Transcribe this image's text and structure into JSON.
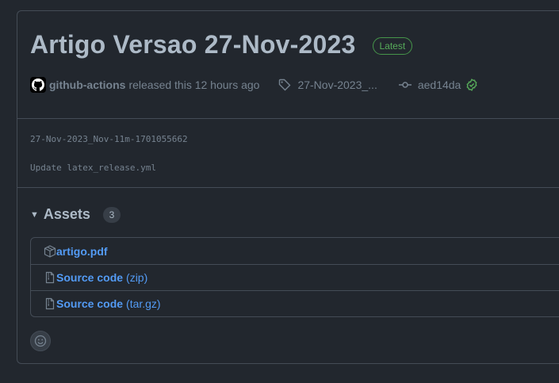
{
  "release": {
    "title": "Artigo Versao 27-Nov-2023",
    "badge": "Latest",
    "author": "github-actions",
    "released_text": "released this 12 hours ago",
    "tag": "27-Nov-2023_...",
    "commit": "aed14da",
    "body_line1": "27-Nov-2023_Nov-11m-1701055662",
    "body_line2": "Update latex_release.yml"
  },
  "assets": {
    "title": "Assets",
    "count": "3",
    "items": [
      {
        "name": "artigo.pdf",
        "ext": "",
        "icon": "package-icon"
      },
      {
        "name": "Source code",
        "ext": "(zip)",
        "icon": "file-zip-icon"
      },
      {
        "name": "Source code",
        "ext": "(tar.gz)",
        "icon": "file-zip-icon"
      }
    ]
  },
  "colors": {
    "background": "#22272e",
    "border": "#444c56",
    "link": "#539bf5",
    "success": "#57ab5a"
  }
}
